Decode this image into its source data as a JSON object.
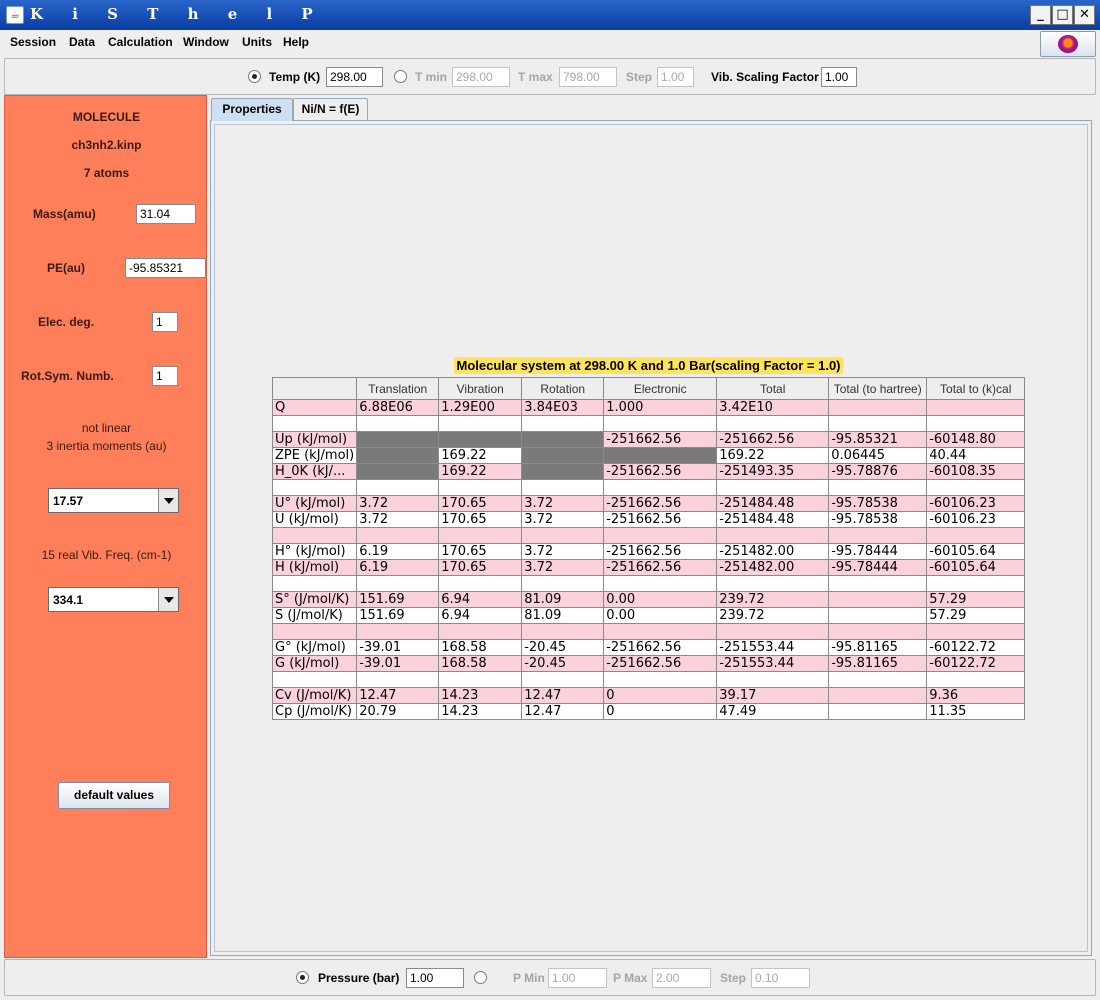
{
  "window": {
    "title": "K i S T h e l P"
  },
  "menu": [
    "Session",
    "Data",
    "Calculation",
    "Window",
    "Units",
    "Help"
  ],
  "temp_bar": {
    "temp_label": "Temp (K)",
    "temp_value": "298.00",
    "tmin_label": "T min",
    "tmin_value": "298.00",
    "tmax_label": "T max",
    "tmax_value": "798.00",
    "step_label": "Step",
    "step_value": "1.00",
    "vib_label": "Vib. Scaling Factor",
    "vib_value": "1.00"
  },
  "left_panel": {
    "header": "MOLECULE",
    "filename": "ch3nh2.kinp",
    "atoms": "7 atoms",
    "mass_label": "Mass(amu)",
    "mass_value": "31.04",
    "pe_label": "PE(au)",
    "pe_value": "-95.85321",
    "elec_label": "Elec. deg.",
    "elec_value": "1",
    "rot_label": "Rot.Sym. Numb.",
    "rot_value": "1",
    "linearity": "not linear",
    "inertia": "3 inertia moments (au)",
    "inertia_selected": "17.57",
    "freq_label": "15 real Vib. Freq. (cm-1)",
    "freq_selected": "334.1",
    "default_button": "default values"
  },
  "tabs": [
    "Properties",
    "Ni/N = f(E)"
  ],
  "table": {
    "title": "Molecular system at 298.00 K and 1.0 Bar(scaling Factor = 1.0)",
    "headers": [
      "",
      "Translation",
      "Vibration",
      "Rotation",
      "Electronic",
      "Total",
      "Total (to hartree)",
      "Total to (k)cal"
    ],
    "rows": [
      [
        "Q",
        "6.88E06",
        "1.29E00",
        "3.84E03",
        "1.000",
        "3.42E10",
        "",
        ""
      ],
      [
        "",
        "",
        "",
        "",
        "",
        "",
        "",
        ""
      ],
      [
        "Up (kJ/mol)",
        "",
        "",
        "",
        "-251662.56",
        "-251662.56",
        "-95.85321",
        "-60148.80"
      ],
      [
        "ZPE (kJ/mol)",
        "",
        "169.22",
        "",
        "",
        "169.22",
        "0.06445",
        "40.44"
      ],
      [
        "H_0K (kJ/...",
        "",
        "169.22",
        "",
        "-251662.56",
        "-251493.35",
        "-95.78876",
        "-60108.35"
      ],
      [
        "",
        "",
        "",
        "",
        "",
        "",
        "",
        ""
      ],
      [
        "U° (kJ/mol)",
        "3.72",
        "170.65",
        "3.72",
        "-251662.56",
        "-251484.48",
        "-95.78538",
        "-60106.23"
      ],
      [
        "U  (kJ/mol)",
        "3.72",
        "170.65",
        "3.72",
        "-251662.56",
        "-251484.48",
        "-95.78538",
        "-60106.23"
      ],
      [
        "",
        "",
        "",
        "",
        "",
        "",
        "",
        ""
      ],
      [
        "H° (kJ/mol)",
        "6.19",
        "170.65",
        "3.72",
        "-251662.56",
        "-251482.00",
        "-95.78444",
        "-60105.64"
      ],
      [
        "H  (kJ/mol)",
        "6.19",
        "170.65",
        "3.72",
        "-251662.56",
        "-251482.00",
        "-95.78444",
        "-60105.64"
      ],
      [
        "",
        "",
        "",
        "",
        "",
        "",
        "",
        ""
      ],
      [
        "S° (J/mol/K)",
        "151.69",
        "6.94",
        "81.09",
        "0.00",
        "239.72",
        "",
        "57.29"
      ],
      [
        "S  (J/mol/K)",
        "151.69",
        "6.94",
        "81.09",
        "0.00",
        "239.72",
        "",
        "57.29"
      ],
      [
        "",
        "",
        "",
        "",
        "",
        "",
        "",
        ""
      ],
      [
        "G° (kJ/mol)",
        "-39.01",
        "168.58",
        "-20.45",
        "-251662.56",
        "-251553.44",
        "-95.81165",
        "-60122.72"
      ],
      [
        "G  (kJ/mol)",
        "-39.01",
        "168.58",
        "-20.45",
        "-251662.56",
        "-251553.44",
        "-95.81165",
        "-60122.72"
      ],
      [
        "",
        "",
        "",
        "",
        "",
        "",
        "",
        ""
      ],
      [
        "Cv (J/mol/K)",
        "12.47",
        "14.23",
        "12.47",
        "0",
        "39.17",
        "",
        "9.36"
      ],
      [
        "Cp (J/mol/K)",
        "20.79",
        "14.23",
        "12.47",
        "0",
        "47.49",
        "",
        "11.35"
      ]
    ]
  },
  "pressure_bar": {
    "pressure_label": "Pressure (bar)",
    "pressure_value": "1.00",
    "pmin_label": "P Min",
    "pmin_value": "1.00",
    "pmax_label": "P Max",
    "pmax_value": "2.00",
    "step_label": "Step",
    "step_value": "0.10"
  },
  "colors": {
    "left_panel": "#ff7f5a",
    "pink_row": "#fbd2dc",
    "title_highlight": "#ffe35a",
    "gray_cell": "#7a7a7a"
  }
}
